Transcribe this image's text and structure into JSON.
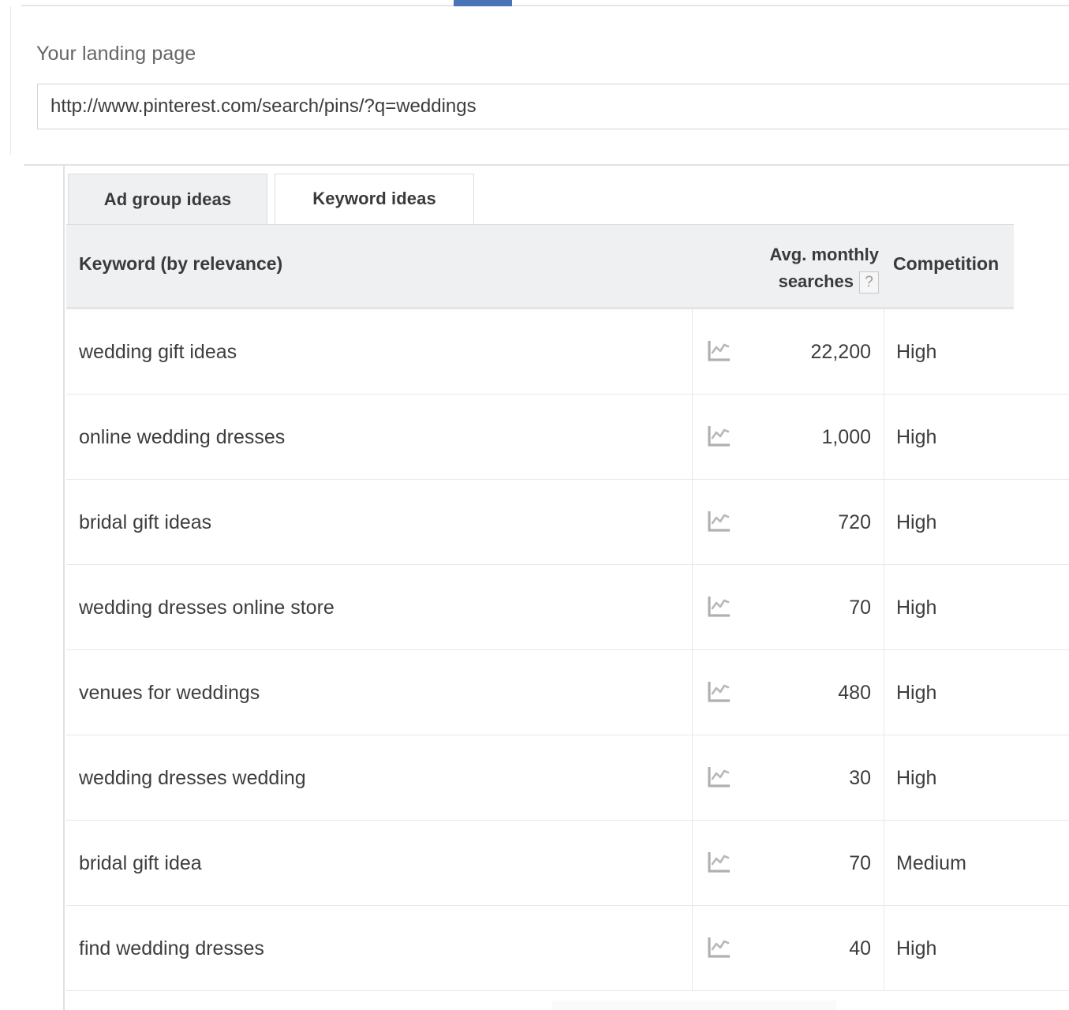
{
  "landing": {
    "label": "Your landing page",
    "url_value": "http://www.pinterest.com/search/pins/?q=weddings",
    "url_placeholder": "Enter a landing page"
  },
  "tabs": [
    {
      "label": "Ad group ideas",
      "active": false
    },
    {
      "label": "Keyword ideas",
      "active": true
    }
  ],
  "table": {
    "columns": {
      "keyword": "Keyword (by relevance)",
      "searches_line1": "Avg. monthly",
      "searches_line2": "searches",
      "searches_help": "?",
      "competition": "Competition"
    },
    "rows": [
      {
        "keyword": "wedding gift ideas",
        "searches": "22,200",
        "competition": "High",
        "trend_icon": "line-chart-icon"
      },
      {
        "keyword": "online wedding dresses",
        "searches": "1,000",
        "competition": "High",
        "trend_icon": "line-chart-icon"
      },
      {
        "keyword": "bridal gift ideas",
        "searches": "720",
        "competition": "High",
        "trend_icon": "line-chart-icon"
      },
      {
        "keyword": "wedding dresses online store",
        "searches": "70",
        "competition": "High",
        "trend_icon": "line-chart-icon"
      },
      {
        "keyword": "venues for weddings",
        "searches": "480",
        "competition": "High",
        "trend_icon": "line-chart-icon"
      },
      {
        "keyword": "wedding dresses wedding",
        "searches": "30",
        "competition": "High",
        "trend_icon": "line-chart-icon"
      },
      {
        "keyword": "bridal gift idea",
        "searches": "70",
        "competition": "Medium",
        "trend_icon": "line-chart-icon"
      },
      {
        "keyword": "find wedding dresses",
        "searches": "40",
        "competition": "High",
        "trend_icon": "line-chart-icon"
      }
    ]
  },
  "colors": {
    "accent_blue": "#4a74b8",
    "header_bg": "#eef0f1",
    "border_gray": "#e8e8e8",
    "text_dark": "#3d3d3d",
    "label_gray": "#666666"
  }
}
